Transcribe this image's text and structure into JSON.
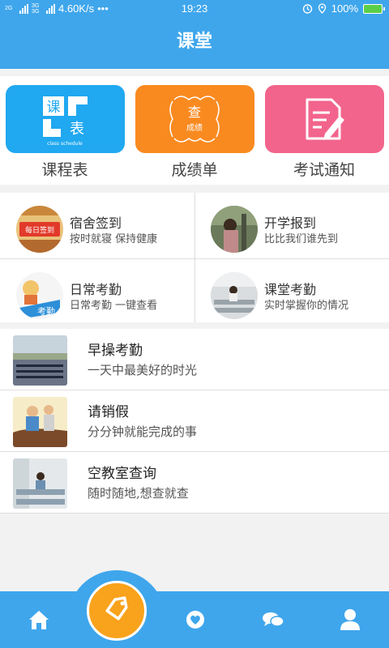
{
  "status": {
    "network_speed": "4.60K/s",
    "dots": "•••",
    "time": "19:23",
    "battery": "100%",
    "sim1": "2G",
    "sim2": "3G 3G"
  },
  "header": {
    "title": "课堂"
  },
  "top_tiles": [
    {
      "label": "课程表",
      "icon_text_1": "课",
      "icon_text_2": "表",
      "icon_sub": "class schedule",
      "icon": "schedule-icon",
      "color": "#20a8f0"
    },
    {
      "label": "成绩单",
      "icon_text_1": "查",
      "icon_text_2": "成绩",
      "icon": "grade-report-icon",
      "color": "#f98a20"
    },
    {
      "label": "考试通知",
      "icon": "exam-notice-icon",
      "color": "#f2648c"
    }
  ],
  "grid": [
    {
      "title": "宿舍签到",
      "subtitle": "按时就寝 保持健康",
      "thumb_text": "每日签到"
    },
    {
      "title": "开学报到",
      "subtitle": "比比我们谁先到"
    },
    {
      "title": "日常考勤",
      "subtitle": "日常考勤 一键查看",
      "thumb_text": "考勤"
    },
    {
      "title": "课堂考勤",
      "subtitle": "实时掌握你的情况"
    }
  ],
  "list": [
    {
      "title": "早操考勤",
      "subtitle": "一天中最美好的时光"
    },
    {
      "title": "请销假",
      "subtitle": "分分钟就能完成的事"
    },
    {
      "title": "空教室查询",
      "subtitle": "随时随地,想查就查"
    }
  ],
  "tabbar": {
    "items": [
      "home-icon",
      "tag-icon",
      "heart-icon",
      "chat-icon",
      "user-icon"
    ],
    "accent": "#3fa6ec",
    "fab_color": "#f9a21b"
  }
}
